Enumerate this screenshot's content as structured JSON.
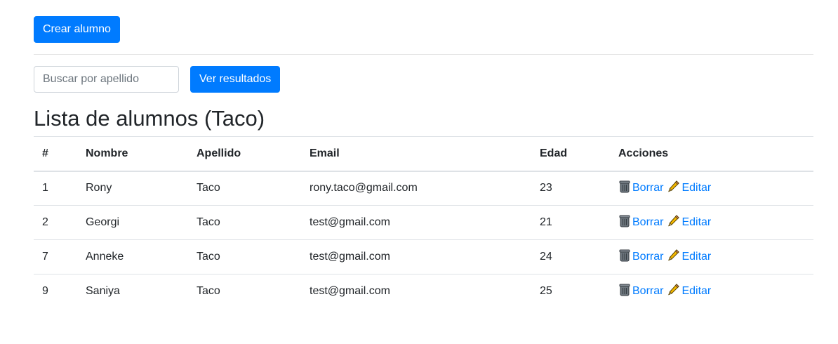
{
  "toolbar": {
    "create_label": "Crear alumno"
  },
  "search": {
    "placeholder": "Buscar por apellido",
    "value": "",
    "button_label": "Ver resultados"
  },
  "page": {
    "title": "Lista de alumnos (Taco)"
  },
  "table": {
    "headers": [
      "#",
      "Nombre",
      "Apellido",
      "Email",
      "Edad",
      "Acciones"
    ],
    "rows": [
      {
        "id": "1",
        "nombre": "Rony",
        "apellido": "Taco",
        "email": "rony.taco@gmail.com",
        "edad": "23"
      },
      {
        "id": "2",
        "nombre": "Georgi",
        "apellido": "Taco",
        "email": "test@gmail.com",
        "edad": "21"
      },
      {
        "id": "7",
        "nombre": "Anneke",
        "apellido": "Taco",
        "email": "test@gmail.com",
        "edad": "24"
      },
      {
        "id": "9",
        "nombre": "Saniya",
        "apellido": "Taco",
        "email": "test@gmail.com",
        "edad": "25"
      }
    ],
    "actions": {
      "delete_label": "Borrar",
      "edit_label": "Editar",
      "delete_icon": "trash-can-icon",
      "edit_icon": "pencil-icon"
    }
  },
  "colors": {
    "primary": "#007bff",
    "border": "#dee2e6",
    "text": "#212529"
  }
}
